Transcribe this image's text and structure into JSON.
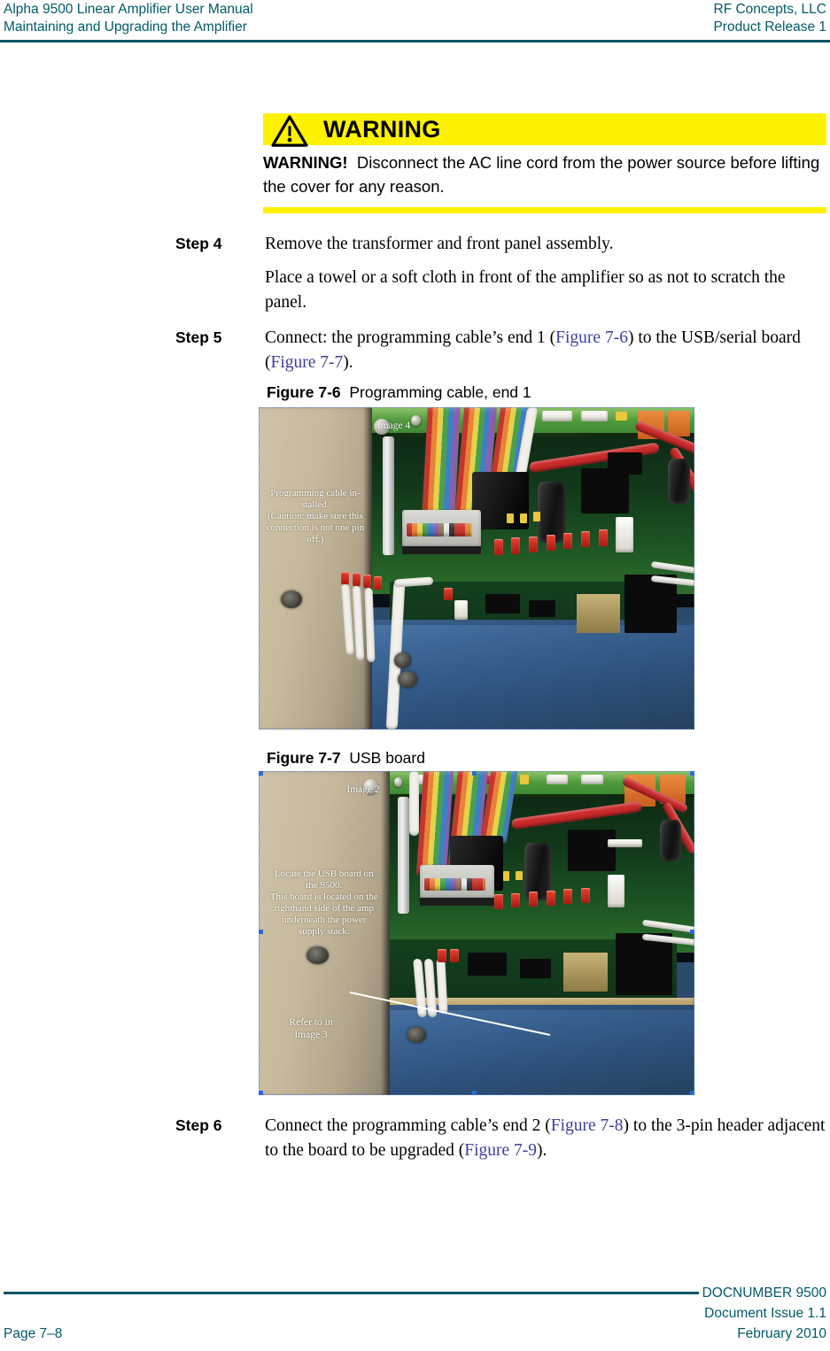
{
  "header": {
    "left_line1": "Alpha 9500 Linear Amplifier User Manual",
    "left_line2": "Maintaining and Upgrading the Amplifier",
    "right_line1": "RF Concepts, LLC",
    "right_line2": "Product Release 1",
    "rule_color": "#005566"
  },
  "warning": {
    "icon": "warning-triangle-icon",
    "title": "WARNING",
    "lead": "WARNING!",
    "body": "Disconnect the AC line cord from the power source before lifting the cover for any reason.",
    "band_color": "#fff200"
  },
  "steps": [
    {
      "label": "Step 4",
      "paragraphs": [
        [
          {
            "t": "Remove the transformer and front panel assembly.",
            "link": false
          }
        ],
        [
          {
            "t": "Place a towel or a soft cloth in front of the amplifier so as not to scratch the panel.",
            "link": false
          }
        ]
      ]
    },
    {
      "label": "Step 5",
      "paragraphs": [
        [
          {
            "t": "Connect: the programming cable’s end 1 (",
            "link": false
          },
          {
            "t": "Figure 7-6",
            "link": true
          },
          {
            "t": ") to the USB/serial board (",
            "link": false
          },
          {
            "t": "Figure 7-7",
            "link": true
          },
          {
            "t": ").",
            "link": false
          }
        ]
      ]
    },
    {
      "label": "Step 6",
      "paragraphs": [
        [
          {
            "t": "Connect the programming cable’s end 2 (",
            "link": false
          },
          {
            "t": "Figure 7-8",
            "link": true
          },
          {
            "t": ") to the 3-pin header adjacent to the board to be upgraded (",
            "link": false
          },
          {
            "t": "Figure 7-9",
            "link": true
          },
          {
            "t": ").",
            "link": false
          }
        ]
      ]
    }
  ],
  "figures": [
    {
      "number": "Figure 7-6",
      "title": "Programming cable, end 1",
      "alt": "Photograph of amplifier interior showing the programming ribbon cable installed on the USB/serial board",
      "annotations": [
        {
          "name": "image-label",
          "text": "Image 4"
        },
        {
          "name": "cable-installed-note",
          "text": "Programming cable in-\nstalled.\n(Caution: make sure this\nconnection is not one pin\noff.)"
        }
      ]
    },
    {
      "number": "Figure 7-7",
      "title": "USB board",
      "alt": "Photograph of the amplifier interior identifying the location of the USB board beneath the power supply stack",
      "annotations": [
        {
          "name": "image-label",
          "text": "Image 2"
        },
        {
          "name": "locate-usb-note",
          "text": "Locate the USB board on\nthe 9500.\nThis board is located on the\nrighthand side of the amp\nunderneath the power\nsupply stack."
        },
        {
          "name": "refer-note",
          "text": "Refer to in\nImage 3"
        }
      ]
    }
  ],
  "footer": {
    "doc_number": "DOCNUMBER 9500",
    "issue": "Document Issue 1.1",
    "date": "February 2010",
    "page": "Page 7–8",
    "rule_color": "#005566"
  },
  "link_color": "#3b3fa0"
}
